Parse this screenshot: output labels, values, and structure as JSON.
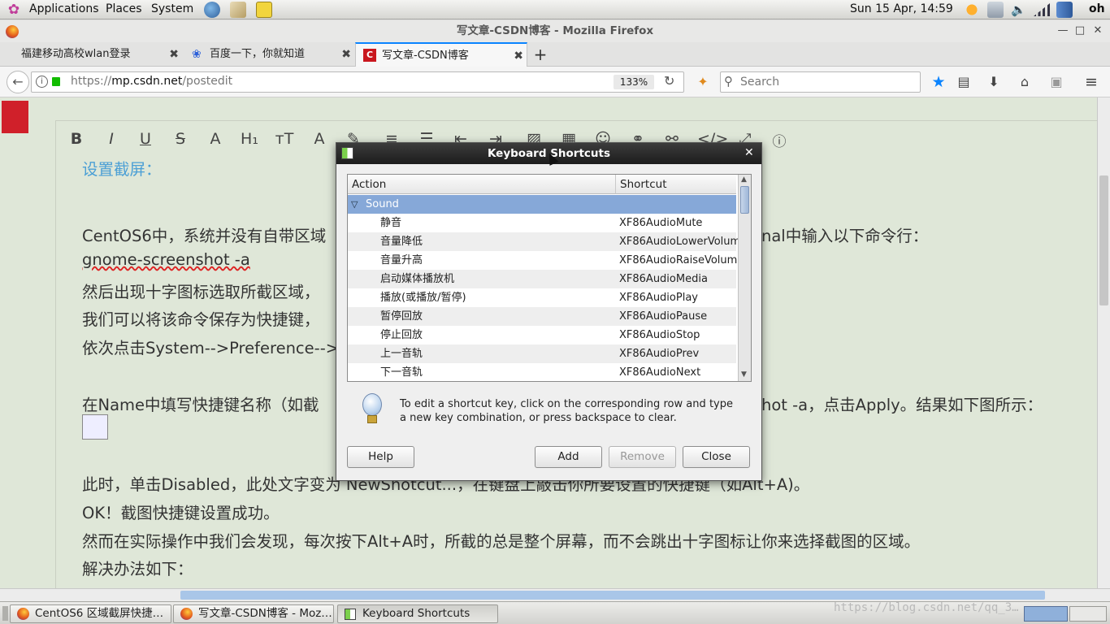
{
  "panel": {
    "menus": [
      "Applications",
      "Places",
      "System"
    ],
    "clock": "Sun 15 Apr, 14:59",
    "user": "oh"
  },
  "window": {
    "title": "写文章-CSDN博客 - Mozilla Firefox"
  },
  "tabs": [
    {
      "label": "福建移动高校wlan登录"
    },
    {
      "label": "百度一下，你就知道"
    },
    {
      "label": "写文章-CSDN博客"
    }
  ],
  "nav": {
    "url": "https://mp.csdn.net/postedit",
    "url_host": "mp.csdn.net",
    "zoom": "133%",
    "search_placeholder": "Search"
  },
  "editor": {
    "heading": "设置截屏：",
    "lines": [
      "CentOS6中，系统并没有自带区域",
      "gnome-screenshot -a",
      "然后出现十字图标选取所截区域，",
      "我们可以将该命令保存为快捷键，",
      "依次点击System-->Preference-->",
      "在Name中填写快捷键名称（如截",
      "此时，单击Disabled，此处文字变为 NewShotcut...，在键盘上敲击你所要设置的快捷键（如Alt+A)。",
      "OK！截图快捷键设置成功。",
      "然而在实际操作中我们会发现，每次按下Alt+A时，所截的总是整个屏幕，而不会跳出十字图标让你来选择截图的区域。",
      "解决办法如下："
    ],
    "line1_right": "nal中输入以下命令行：",
    "line6_right": "hot -a，点击Apply。结果如下图所示："
  },
  "dialog": {
    "title": "Keyboard Shortcuts",
    "columns": [
      "Action",
      "Shortcut"
    ],
    "group": "Sound",
    "rows": [
      {
        "action": "静音",
        "shortcut": "XF86AudioMute"
      },
      {
        "action": "音量降低",
        "shortcut": "XF86AudioLowerVolum"
      },
      {
        "action": "音量升高",
        "shortcut": "XF86AudioRaiseVolum"
      },
      {
        "action": "启动媒体播放机",
        "shortcut": "XF86AudioMedia"
      },
      {
        "action": "播放(或播放/暂停)",
        "shortcut": "XF86AudioPlay"
      },
      {
        "action": "暂停回放",
        "shortcut": "XF86AudioPause"
      },
      {
        "action": "停止回放",
        "shortcut": "XF86AudioStop"
      },
      {
        "action": "上一音轨",
        "shortcut": "XF86AudioPrev"
      },
      {
        "action": "下一音轨",
        "shortcut": "XF86AudioNext"
      }
    ],
    "info": "To edit a shortcut key, click on the corresponding row and type a new key combination, or press backspace to clear.",
    "buttons": {
      "help": "Help",
      "add": "Add",
      "remove": "Remove",
      "close": "Close"
    }
  },
  "taskbar": [
    {
      "label": "CentOS6 区域截屏快捷…"
    },
    {
      "label": "写文章-CSDN博客 - Moz…"
    },
    {
      "label": "Keyboard Shortcuts"
    }
  ],
  "watermark": "https://blog.csdn.net/qq_3…"
}
